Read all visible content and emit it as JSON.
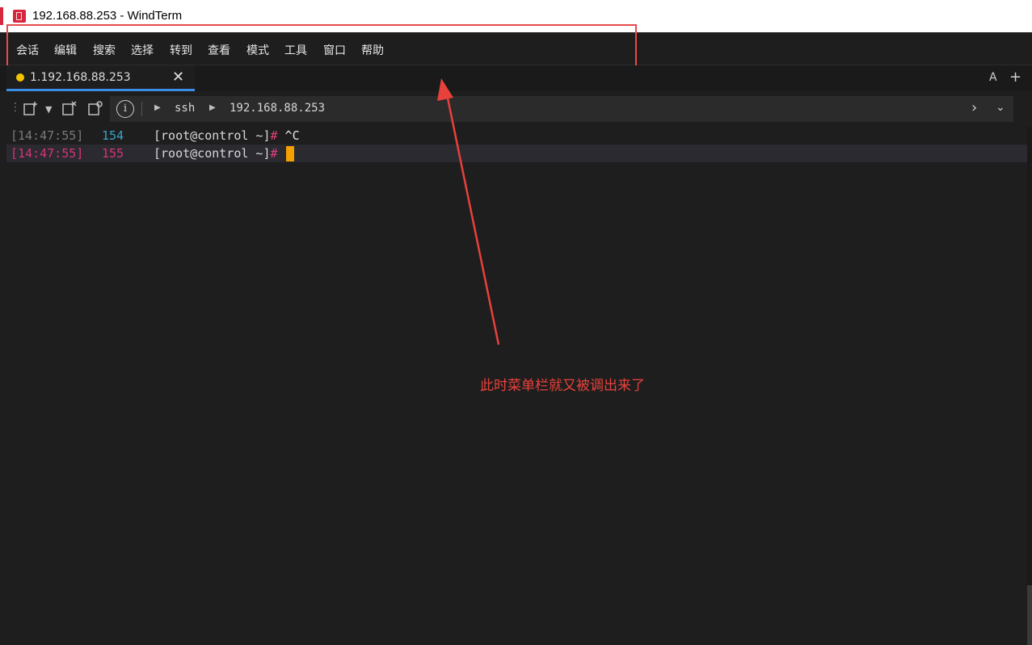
{
  "window": {
    "title": "192.168.88.253 - WindTerm",
    "accent": "#d7263d"
  },
  "menu": {
    "items": [
      "会话",
      "编辑",
      "搜索",
      "选择",
      "转到",
      "查看",
      "模式",
      "工具",
      "窗口",
      "帮助"
    ]
  },
  "tabs": {
    "active": {
      "label": "1.192.168.88.253",
      "close": "✕",
      "status_color": "#f5c400"
    },
    "right_controls": {
      "font": "A",
      "add": "+",
      "more": "⋮"
    }
  },
  "address": {
    "info_icon": "i",
    "segments": [
      "ssh",
      "192.168.88.253"
    ]
  },
  "terminal": {
    "lines": [
      {
        "time": "[14:47:55]",
        "number": "154",
        "prompt": "[root@control ~]",
        "hash": "#",
        "command": " ^C",
        "time_color": "#7a7a7a",
        "number_color": "#3ba3c8"
      },
      {
        "time": "[14:47:55]",
        "number": "155",
        "prompt": "[root@control ~]",
        "hash": "#",
        "command": "",
        "time_color": "#d8337a",
        "number_color": "#d8337a"
      }
    ],
    "cursor_color": "#f5a000"
  },
  "annotation": {
    "text": "此时菜单栏就又被调出来了",
    "color": "#e8413b"
  }
}
